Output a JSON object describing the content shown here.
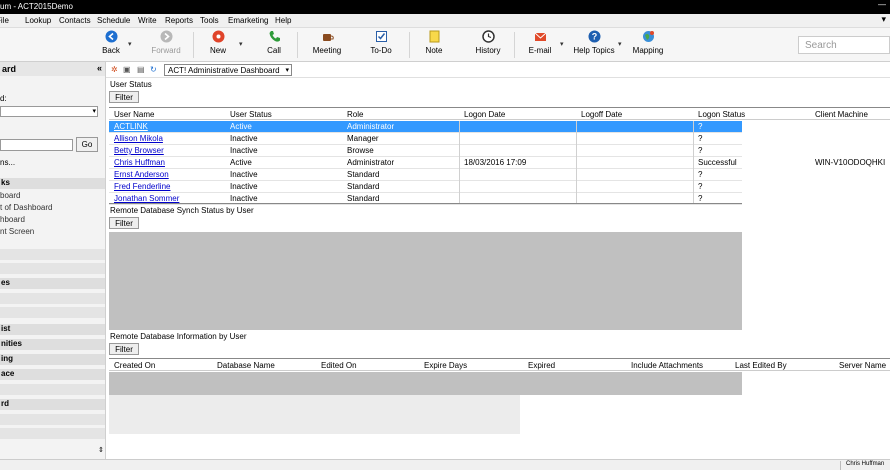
{
  "window": {
    "title": "um - ACT2015Demo",
    "minimize": "—"
  },
  "menu": [
    "File",
    "Lookup",
    "Contacts",
    "Schedule",
    "Write",
    "Reports",
    "Tools",
    "Emarketing",
    "Help"
  ],
  "toolbar": {
    "back": "Back",
    "forward": "Forward",
    "new": "New",
    "call": "Call",
    "meeting": "Meeting",
    "todo": "To-Do",
    "note": "Note",
    "history": "History",
    "email": "E-mail",
    "help_topics": "Help Topics",
    "mapping": "Mapping",
    "search_placeholder": "Search"
  },
  "sidebar": {
    "title": "ard",
    "collapse": "«",
    "label1": "d:",
    "label2": "ns...",
    "go": "Go",
    "section_tasks": "ks",
    "items": [
      "board",
      "t of Dashboard",
      "hboard",
      "nt Screen"
    ],
    "section_es": "es",
    "section_ist": "ist",
    "section_nities": "nities",
    "section_ing": "ing",
    "section_ace": "ace",
    "section_rd": "rd"
  },
  "dashboard": {
    "selected": "ACT! Administrative Dashboard",
    "user_status": {
      "title": "User Status",
      "filter": "Filter",
      "columns": [
        "User Name",
        "User Status",
        "Role",
        "Logon Date",
        "Logoff Date",
        "Logon Status",
        "Client Machine"
      ],
      "rows": [
        {
          "name": "ACTLINK",
          "status": "Active",
          "role": "Administrator",
          "logon": "",
          "logoff": "",
          "logon_status": "?",
          "machine": ""
        },
        {
          "name": "Allison Mikola",
          "status": "Inactive",
          "role": "Manager",
          "logon": "",
          "logoff": "",
          "logon_status": "?",
          "machine": ""
        },
        {
          "name": "Betty Browser",
          "status": "Inactive",
          "role": "Browse",
          "logon": "",
          "logoff": "",
          "logon_status": "?",
          "machine": ""
        },
        {
          "name": "Chris Huffman",
          "status": "Active",
          "role": "Administrator",
          "logon": "18/03/2016 17:09",
          "logoff": "",
          "logon_status": "Successful",
          "machine": "WIN-V10ODOQHKI"
        },
        {
          "name": "Ernst Anderson",
          "status": "Inactive",
          "role": "Standard",
          "logon": "",
          "logoff": "",
          "logon_status": "?",
          "machine": ""
        },
        {
          "name": "Fred Fenderline",
          "status": "Inactive",
          "role": "Standard",
          "logon": "",
          "logoff": "",
          "logon_status": "?",
          "machine": ""
        },
        {
          "name": "Jonathan Sommer",
          "status": "Inactive",
          "role": "Standard",
          "logon": "",
          "logoff": "",
          "logon_status": "?",
          "machine": ""
        }
      ]
    },
    "remote_sync": {
      "title": "Remote Database Synch Status by User",
      "filter": "Filter"
    },
    "remote_info": {
      "title": "Remote Database Information by User",
      "filter": "Filter",
      "columns": [
        "Created On",
        "Database Name",
        "Edited On",
        "Expire Days",
        "Expired",
        "Include Attachments",
        "Last Edited By",
        "Server Name"
      ]
    }
  },
  "status_bar": {
    "user": "Chris Huffman"
  }
}
